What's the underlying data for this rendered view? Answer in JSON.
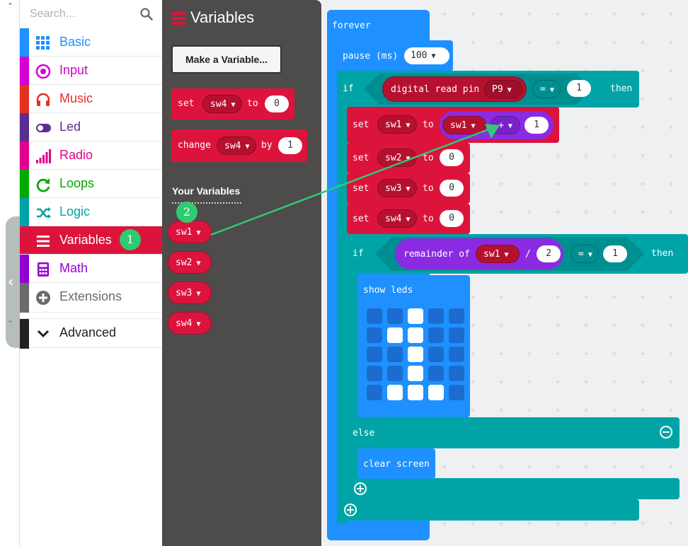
{
  "search": {
    "placeholder": "Search..."
  },
  "categories": [
    {
      "label": "Basic",
      "color": "#1e90ff",
      "icon": "grid-icon"
    },
    {
      "label": "Input",
      "color": "#d400d4",
      "icon": "input-circle-icon"
    },
    {
      "label": "Music",
      "color": "#e63022",
      "icon": "headphones-icon"
    },
    {
      "label": "Led",
      "color": "#5c2d91",
      "icon": "toggle-icon"
    },
    {
      "label": "Radio",
      "color": "#e3008c",
      "icon": "signal-bars-icon"
    },
    {
      "label": "Loops",
      "color": "#00aa00",
      "icon": "refresh-icon"
    },
    {
      "label": "Logic",
      "color": "#00a4a6",
      "icon": "shuffle-icon"
    },
    {
      "label": "Variables",
      "color": "#dc143c",
      "icon": "list-icon"
    },
    {
      "label": "Math",
      "color": "#9400d3",
      "icon": "calculator-icon"
    },
    {
      "label": "Extensions",
      "color": "#6b6b6b",
      "icon": "plus-circle-icon"
    },
    {
      "label": "Advanced",
      "color": "#222222",
      "icon": "chevron-down-icon"
    }
  ],
  "flyout": {
    "title": "Variables",
    "make_variable": "Make a Variable...",
    "set_block": {
      "kw": "set",
      "var": "sw4",
      "to": "to",
      "value": "0"
    },
    "change_block": {
      "kw": "change",
      "var": "sw4",
      "by": "by",
      "value": "1"
    },
    "your_variables": "Your Variables",
    "variables": [
      "sw1",
      "sw2",
      "sw3",
      "sw4"
    ]
  },
  "badges": {
    "one": "1",
    "two": "2"
  },
  "workspace": {
    "forever": "forever",
    "pause": {
      "label": "pause (ms)",
      "value": "100"
    },
    "if1": {
      "kw": "if",
      "read": "digital read pin",
      "pin": "P9",
      "op": "=",
      "value": "1",
      "then": "then"
    },
    "set_sw1": {
      "kw": "set",
      "var": "sw1",
      "to": "to",
      "lhs": "sw1",
      "op": "+",
      "rhs": "1"
    },
    "set_sw2": {
      "kw": "set",
      "var": "sw2",
      "to": "to",
      "value": "0"
    },
    "set_sw3": {
      "kw": "set",
      "var": "sw3",
      "to": "to",
      "value": "0"
    },
    "set_sw4": {
      "kw": "set",
      "var": "sw4",
      "to": "to",
      "value": "0"
    },
    "if2": {
      "kw": "if",
      "rem": "remainder of",
      "var": "sw1",
      "div": "/",
      "divisor": "2",
      "op": "=",
      "value": "1",
      "then": "then"
    },
    "show_leds": "show leds",
    "leds": [
      [
        0,
        0,
        1,
        0,
        0
      ],
      [
        0,
        1,
        1,
        0,
        0
      ],
      [
        0,
        0,
        1,
        0,
        0
      ],
      [
        0,
        0,
        1,
        0,
        0
      ],
      [
        0,
        1,
        1,
        1,
        0
      ]
    ],
    "else": "else",
    "clear_screen": "clear screen"
  },
  "colors": {
    "variables": "#dc143c",
    "logic": "#00a4a6",
    "basic": "#1e90ff",
    "math": "#8a2be2",
    "arrow": "#2ecc71"
  }
}
